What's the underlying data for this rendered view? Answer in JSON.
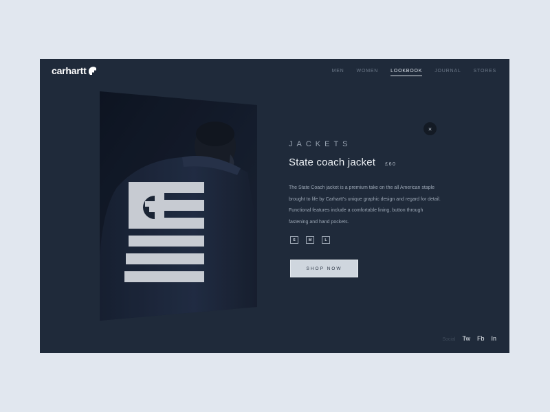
{
  "brand": {
    "logo_text": "carhartt"
  },
  "nav": {
    "items": [
      {
        "label": "MEN"
      },
      {
        "label": "WOMEN"
      },
      {
        "label": "LOOKBOOK",
        "active": true
      },
      {
        "label": "JOURNAL"
      },
      {
        "label": "STORES"
      }
    ]
  },
  "product": {
    "category": "JACKETS",
    "title": "State coach jacket",
    "price": "£60",
    "description": "The State Coach jacket is a premium take on the all American staple brought to life by Carhartt's unique graphic design and regard for detail. Functional features include a comfortable lining, button through fastening and hand pockets.",
    "sizes": [
      "S",
      "M",
      "L"
    ],
    "cta": "SHOP NOW",
    "close_glyph": "×"
  },
  "social": {
    "label": "Social",
    "links": [
      "Tw",
      "Fb",
      "In"
    ]
  },
  "colors": {
    "page_bg": "#e1e7ef",
    "panel_bg": "#1f2a3a",
    "button_bg": "#cfd6de"
  }
}
